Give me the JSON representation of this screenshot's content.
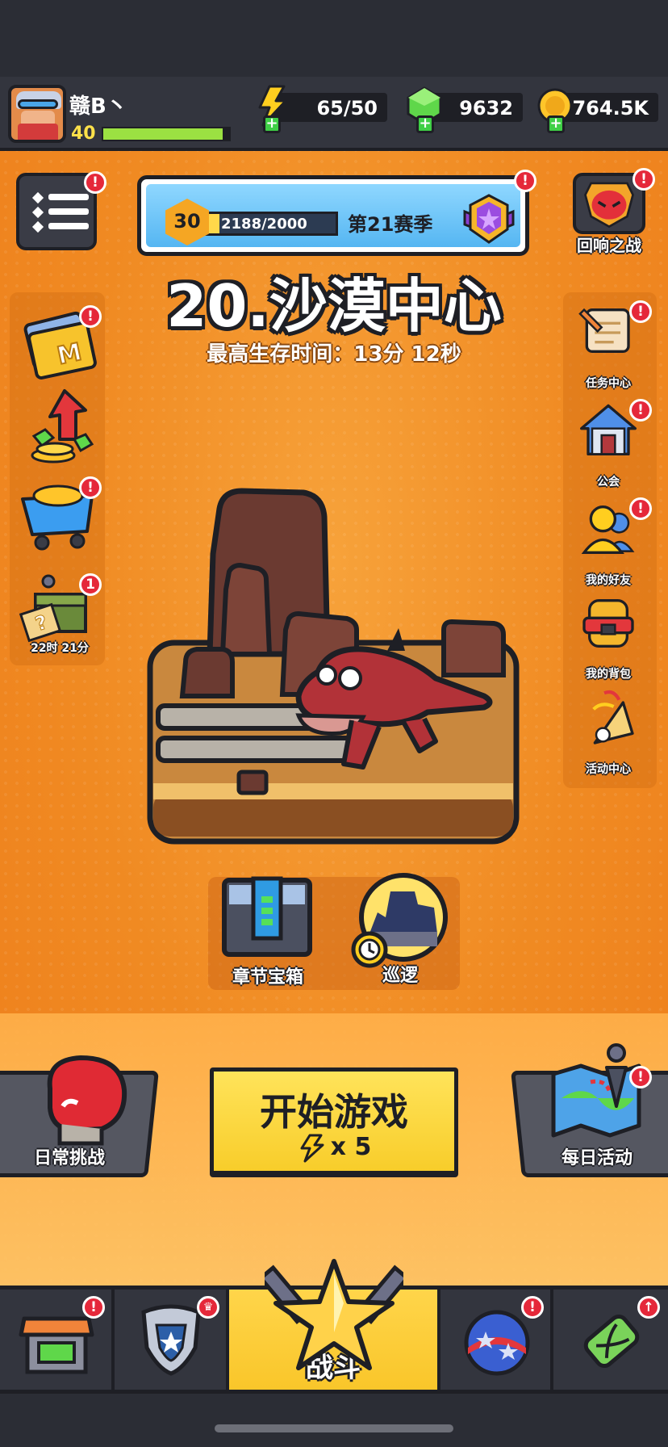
{
  "player": {
    "name": "赣B丶",
    "level": "40",
    "xp_fraction": 0.95
  },
  "resources": {
    "energy": "65/50",
    "gems": "9632",
    "gold": "764.5K"
  },
  "season": {
    "tier": "30",
    "progress_text": "2188/2000",
    "progress_fraction": 1.0,
    "label": "第21赛季"
  },
  "echo_battle": {
    "label": "回响之战"
  },
  "stage": {
    "title": "20.沙漠中心",
    "best_survival": "最高生存时间：13分 12秒"
  },
  "left_menu": {
    "items": [
      {
        "name": "monthly-card",
        "badge": "!"
      },
      {
        "name": "growth-fund",
        "badge": ""
      },
      {
        "name": "shop-cart",
        "badge": "!"
      },
      {
        "name": "mystery-crate",
        "badge": "1",
        "label": "22时 21分"
      }
    ]
  },
  "right_menu": {
    "items": [
      {
        "label": "任务中心",
        "badge": "!"
      },
      {
        "label": "公会",
        "badge": "!"
      },
      {
        "label": "我的好友",
        "badge": "!"
      },
      {
        "label": "我的背包",
        "badge": ""
      },
      {
        "label": "活动中心",
        "badge": ""
      }
    ]
  },
  "chapter_chest": {
    "label": "章节宝箱"
  },
  "patrol": {
    "label": "巡逻"
  },
  "daily_challenge": {
    "label": "日常挑战"
  },
  "daily_events": {
    "label": "每日活动",
    "badge": "!"
  },
  "start": {
    "label": "开始游戏",
    "cost": "x 5"
  },
  "nav": {
    "tabs": [
      {
        "name": "shop",
        "badge": "!"
      },
      {
        "name": "equipment",
        "badge": ""
      },
      {
        "name": "battle",
        "label": "战斗"
      },
      {
        "name": "talents",
        "badge": "!"
      },
      {
        "name": "evolution",
        "badge": ""
      }
    ]
  },
  "menu_badge": "!",
  "season_badge": "!",
  "echo_badge": "!",
  "colors": {
    "background": "#f08a22",
    "topbar": "#33353e",
    "start_button": "#f8cd2a",
    "badge": "#e5283a",
    "xp": "#9be142"
  }
}
